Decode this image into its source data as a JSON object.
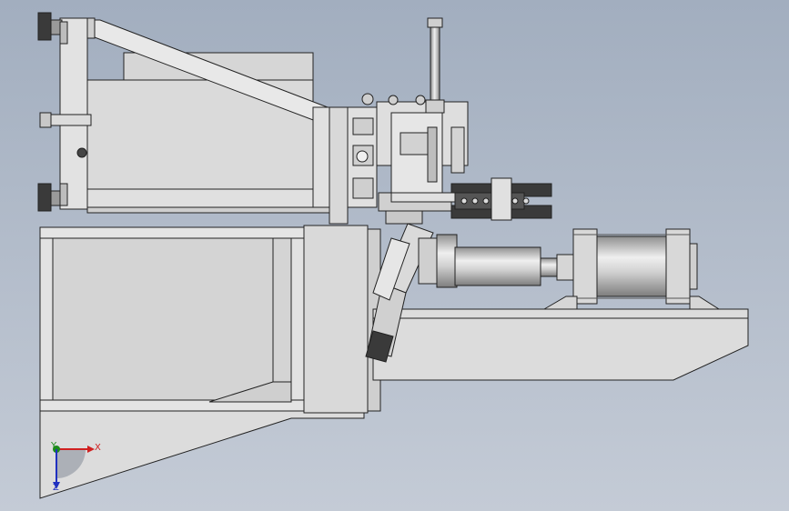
{
  "viewport": {
    "background_top": "#a2aebf",
    "background_bottom": "#c4cbd6"
  },
  "model": {
    "part_fill": "#dcdcdc",
    "part_shade": "#c2c2c2",
    "edge_color": "#222222",
    "dark_part": "#3a3a3a",
    "cylinder_light": "#e6e6e6",
    "cylinder_dark": "#9a9a9a"
  },
  "triad": {
    "x_label": "X",
    "y_label": "Y",
    "z_label": "Z",
    "x_color": "#d02020",
    "y_color": "#1a8a1a",
    "z_color": "#2030c0"
  }
}
